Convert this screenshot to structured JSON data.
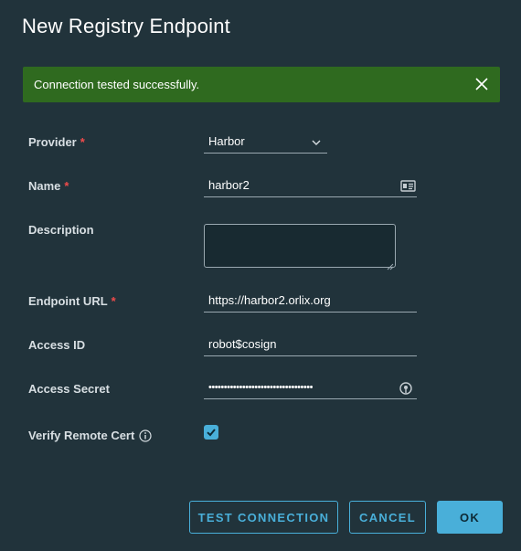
{
  "dialog": {
    "title": "New Registry Endpoint"
  },
  "alert": {
    "message": "Connection tested successfully.",
    "close_icon": "close-icon"
  },
  "form": {
    "provider": {
      "label": "Provider",
      "required": "*",
      "value": "Harbor"
    },
    "name": {
      "label": "Name",
      "required": "*",
      "value": "harbor2"
    },
    "description": {
      "label": "Description",
      "value": ""
    },
    "endpoint_url": {
      "label": "Endpoint URL",
      "required": "*",
      "value": "https://harbor2.orlix.org"
    },
    "access_id": {
      "label": "Access ID",
      "value": "robot$cosign"
    },
    "access_secret": {
      "label": "Access Secret",
      "value": "••••••••••••••••••••••••••••••••••"
    },
    "verify_cert": {
      "label": "Verify Remote Cert",
      "checked": true
    }
  },
  "buttons": {
    "test_connection": "TEST CONNECTION",
    "cancel": "CANCEL",
    "ok": "OK"
  },
  "colors": {
    "background": "#21333b",
    "success": "#2f6a1f",
    "accent": "#49afd9",
    "required": "#f04b4b"
  }
}
